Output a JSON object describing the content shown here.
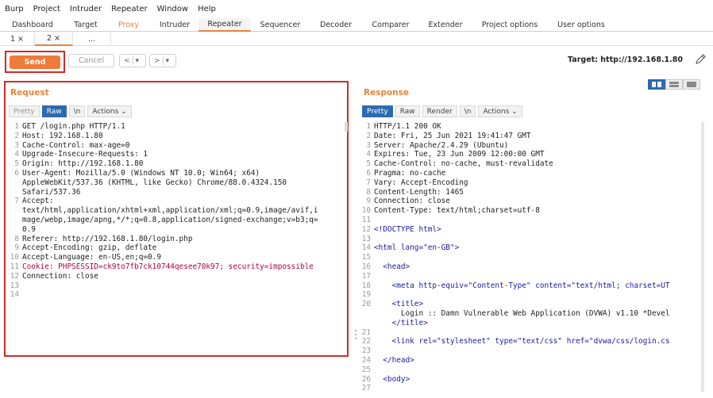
{
  "menu": [
    "Burp",
    "Project",
    "Intruder",
    "Repeater",
    "Window",
    "Help"
  ],
  "tabs": [
    "Dashboard",
    "Target",
    "Proxy",
    "Intruder",
    "Repeater",
    "Sequencer",
    "Decoder",
    "Comparer",
    "Extender",
    "Project options",
    "User options"
  ],
  "subtabs": [
    "1 ×",
    "2 ×",
    "..."
  ],
  "toolbar": {
    "send": "Send",
    "cancel": "Cancel",
    "back": "<",
    "back_drop": "▾",
    "fwd": ">",
    "fwd_drop": "▾",
    "target": "Target: http://192.168.1.80"
  },
  "request": {
    "title": "Request",
    "tabs": [
      "Pretty",
      "Raw",
      "\\n",
      "Actions ⌄"
    ],
    "lines": [
      {
        "n": "1",
        "t": "GET /login.php HTTP/1.1"
      },
      {
        "n": "2",
        "t": "Host: 192.168.1.80"
      },
      {
        "n": "3",
        "t": "Cache-Control: max-age=0"
      },
      {
        "n": "4",
        "t": "Upgrade-Insecure-Requests: 1"
      },
      {
        "n": "5",
        "t": "Origin: http://192.168.1.80"
      },
      {
        "n": "6",
        "t": "User-Agent: Mozilla/5.0 (Windows NT 10.0; Win64; x64)"
      },
      {
        "n": "",
        "t": "AppleWebKit/537.36 (KHTML, like Gecko) Chrome/88.0.4324.150"
      },
      {
        "n": "",
        "t": "Safari/537.36"
      },
      {
        "n": "7",
        "t": "Accept:"
      },
      {
        "n": "",
        "t": "text/html,application/xhtml+xml,application/xml;q=0.9,image/avif,i"
      },
      {
        "n": "",
        "t": "mage/webp,image/apng,*/*;q=0.8,application/signed-exchange;v=b3;q="
      },
      {
        "n": "",
        "t": "0.9"
      },
      {
        "n": "8",
        "t": "Referer: http://192.168.1.80/login.php"
      },
      {
        "n": "9",
        "t": "Accept-Encoding: gzip, deflate"
      },
      {
        "n": "10",
        "t": "Accept-Language: en-US,en;q=0.9"
      },
      {
        "n": "11",
        "t": "Cookie: PHPSESSID=ck9to7fb7ck10744qesee70k97; security=impossible"
      },
      {
        "n": "12",
        "t": "Connection: close"
      },
      {
        "n": "13",
        "t": ""
      },
      {
        "n": "14",
        "t": ""
      }
    ]
  },
  "response": {
    "title": "Response",
    "tabs": [
      "Pretty",
      "Raw",
      "Render",
      "\\n",
      "Actions ⌄"
    ],
    "lines": [
      {
        "n": "1",
        "t": "HTTP/1.1 200 OK"
      },
      {
        "n": "2",
        "t": "Date: Fri, 25 Jun 2021 19:41:47 GMT"
      },
      {
        "n": "3",
        "t": "Server: Apache/2.4.29 (Ubuntu)"
      },
      {
        "n": "4",
        "t": "Expires: Tue, 23 Jun 2009 12:00:00 GMT"
      },
      {
        "n": "5",
        "t": "Cache-Control: no-cache, must-revalidate"
      },
      {
        "n": "6",
        "t": "Pragma: no-cache"
      },
      {
        "n": "7",
        "t": "Vary: Accept-Encoding"
      },
      {
        "n": "8",
        "t": "Content-Length: 1465"
      },
      {
        "n": "9",
        "t": "Connection: close"
      },
      {
        "n": "10",
        "t": "Content-Type: text/html;charset=utf-8"
      },
      {
        "n": "11",
        "t": ""
      },
      {
        "n": "12",
        "t": "<!DOCTYPE html>"
      },
      {
        "n": "13",
        "t": ""
      },
      {
        "n": "14",
        "t": "<html lang=\"en-GB\">"
      },
      {
        "n": "15",
        "t": ""
      },
      {
        "n": "16",
        "t": "  <head>"
      },
      {
        "n": "17",
        "t": ""
      },
      {
        "n": "18",
        "t": "    <meta http-equiv=\"Content-Type\" content=\"text/html; charset=UT"
      },
      {
        "n": "19",
        "t": ""
      },
      {
        "n": "20",
        "t": "    <title>"
      },
      {
        "n": "",
        "t": "      Login :: Damn Vulnerable Web Application (DVWA) v1.10 *Devel"
      },
      {
        "n": "",
        "t": "    </title>"
      },
      {
        "n": "21",
        "t": ""
      },
      {
        "n": "22",
        "t": "    <link rel=\"stylesheet\" type=\"text/css\" href=\"dvwa/css/login.cs"
      },
      {
        "n": "23",
        "t": ""
      },
      {
        "n": "24",
        "t": "  </head>"
      },
      {
        "n": "25",
        "t": ""
      },
      {
        "n": "26",
        "t": "  <body>"
      },
      {
        "n": "27",
        "t": ""
      }
    ]
  },
  "colors": {
    "accent": "#e8833a",
    "highlight": "#d12a2a",
    "selected": "#2d6ab0"
  }
}
